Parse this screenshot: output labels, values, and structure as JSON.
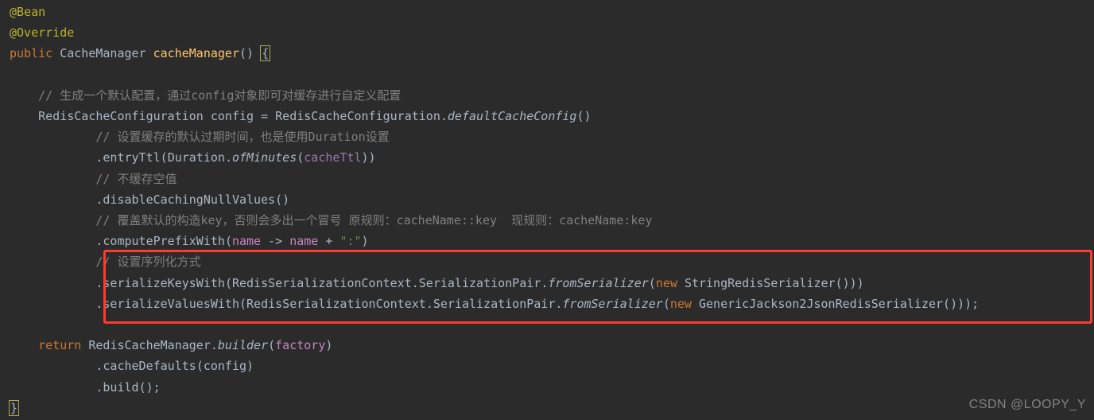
{
  "code": {
    "l1_anno1": "@Bean",
    "l2_anno2": "@Override",
    "l3_kw_public": "public",
    "l3_type": "CacheManager",
    "l3_method": "cacheManager",
    "l3_parens": "()",
    "l3_brace": "{",
    "l5_comment": "// 生成一个默认配置，通过config对象即可对缓存进行自定义配置",
    "l6_type": "RedisCacheConfiguration",
    "l6_var": "config",
    "l6_eq": "=",
    "l6_cls": "RedisCacheConfiguration",
    "l6_dot": ".",
    "l6_static": "defaultCacheConfig",
    "l6_parens": "()",
    "l7_comment": "// 设置缓存的默认过期时间，也是使用Duration设置",
    "l8_dot1": ".",
    "l8_m1": "entryTtl",
    "l8_lp": "(",
    "l8_cls": "Duration",
    "l8_dot2": ".",
    "l8_static": "ofMinutes",
    "l8_lp2": "(",
    "l8_field": "cacheTtl",
    "l8_rp": "))",
    "l9_comment": "// 不缓存空值",
    "l10_dot": ".",
    "l10_m": "disableCachingNullValues",
    "l10_p": "()",
    "l11_comment": "// 覆盖默认的构造key，否则会多出一个冒号 原规则：cacheName::key  现规则：cacheName:key",
    "l12_dot": ".",
    "l12_m": "computePrefixWith",
    "l12_lp": "(",
    "l12_param": "name",
    "l12_arrow": " -> ",
    "l12_param2": "name",
    "l12_plus": " + ",
    "l12_str": "\":\"",
    "l12_rp": ")",
    "l13_comment": "// 设置序列化方式",
    "l14_dot": ".",
    "l14_m": "serializeKeysWith",
    "l14_lp": "(",
    "l14_cls": "RedisSerializationContext",
    "l14_dot2": ".",
    "l14_cls2": "SerializationPair",
    "l14_dot3": ".",
    "l14_static": "fromSerializer",
    "l14_lp2": "(",
    "l14_kw": "new",
    "l14_cls3": "StringRedisSerializer",
    "l14_rp": "()))",
    "l15_dot": ".",
    "l15_m": "serializeValuesWith",
    "l15_lp": "(",
    "l15_cls": "RedisSerializationContext",
    "l15_dot2": ".",
    "l15_cls2": "SerializationPair",
    "l15_dot3": ".",
    "l15_static": "fromSerializer",
    "l15_lp2": "(",
    "l15_kw": "new",
    "l15_cls3": "GenericJackson2JsonRedisSerializer",
    "l15_rp": "()));",
    "l17_kw": "return",
    "l17_cls": "RedisCacheManager",
    "l17_dot": ".",
    "l17_static": "builder",
    "l17_lp": "(",
    "l17_param": "factory",
    "l17_rp": ")",
    "l18_dot": ".",
    "l18_m": "cacheDefaults",
    "l18_lp": "(",
    "l18_var": "config",
    "l18_rp": ")",
    "l19_dot": ".",
    "l19_m": "build",
    "l19_rp": "();",
    "l20_brace": "}"
  },
  "watermark": "CSDN @LOOPY_Y"
}
